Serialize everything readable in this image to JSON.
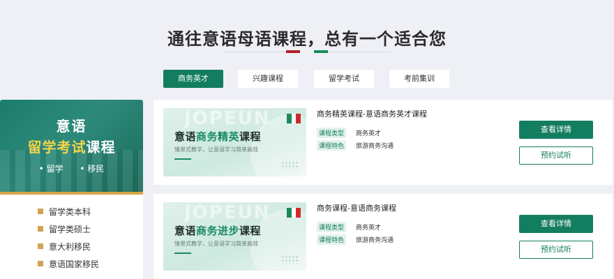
{
  "heading": "通往意语母语课程，总有一个适合您",
  "tabs": [
    {
      "label": "商务英才",
      "active": true
    },
    {
      "label": "兴趣课程",
      "active": false
    },
    {
      "label": "留学考试",
      "active": false
    },
    {
      "label": "考前集训",
      "active": false
    }
  ],
  "sidebar": {
    "banner_line1": "意语",
    "banner_line2_hl": "留学考试",
    "banner_line2_rest": "课程",
    "banner_tags": [
      "• 留学",
      "• 移民"
    ],
    "items": [
      "留学类本科",
      "留学类硕士",
      "意大利移民",
      "意语国家移民"
    ]
  },
  "courses": [
    {
      "img_watermark": "JOPEUN",
      "img_title_prefix": "意语",
      "img_title_hl": "商务精英",
      "img_title_suffix": "课程",
      "img_sub": "情景式教学，让意语学习简单高效",
      "title": "商务精英课程-意语商务英才课程",
      "type_label": "课程类型",
      "type_value": "商务英才",
      "feature_label": "课程特色",
      "feature_value": "旅游商务沟通",
      "detail_btn": "查看详情",
      "trial_btn": "预约试听"
    },
    {
      "img_watermark": "JOPEUN",
      "img_title_prefix": "意语",
      "img_title_hl": "商务进步",
      "img_title_suffix": "课程",
      "img_sub": "情景式教学，让意语学习简单高效",
      "title": "商务课程-意语商务课程",
      "type_label": "课程类型",
      "type_value": "商务英才",
      "feature_label": "课程特色",
      "feature_value": "旅游商务沟通",
      "detail_btn": "查看详情",
      "trial_btn": "预约试听"
    }
  ],
  "colors": {
    "accent_green": "#137d5f",
    "flag_red": "#b3202a",
    "flag_green": "#1b8a5a",
    "bullet_gold": "#d2a257"
  }
}
